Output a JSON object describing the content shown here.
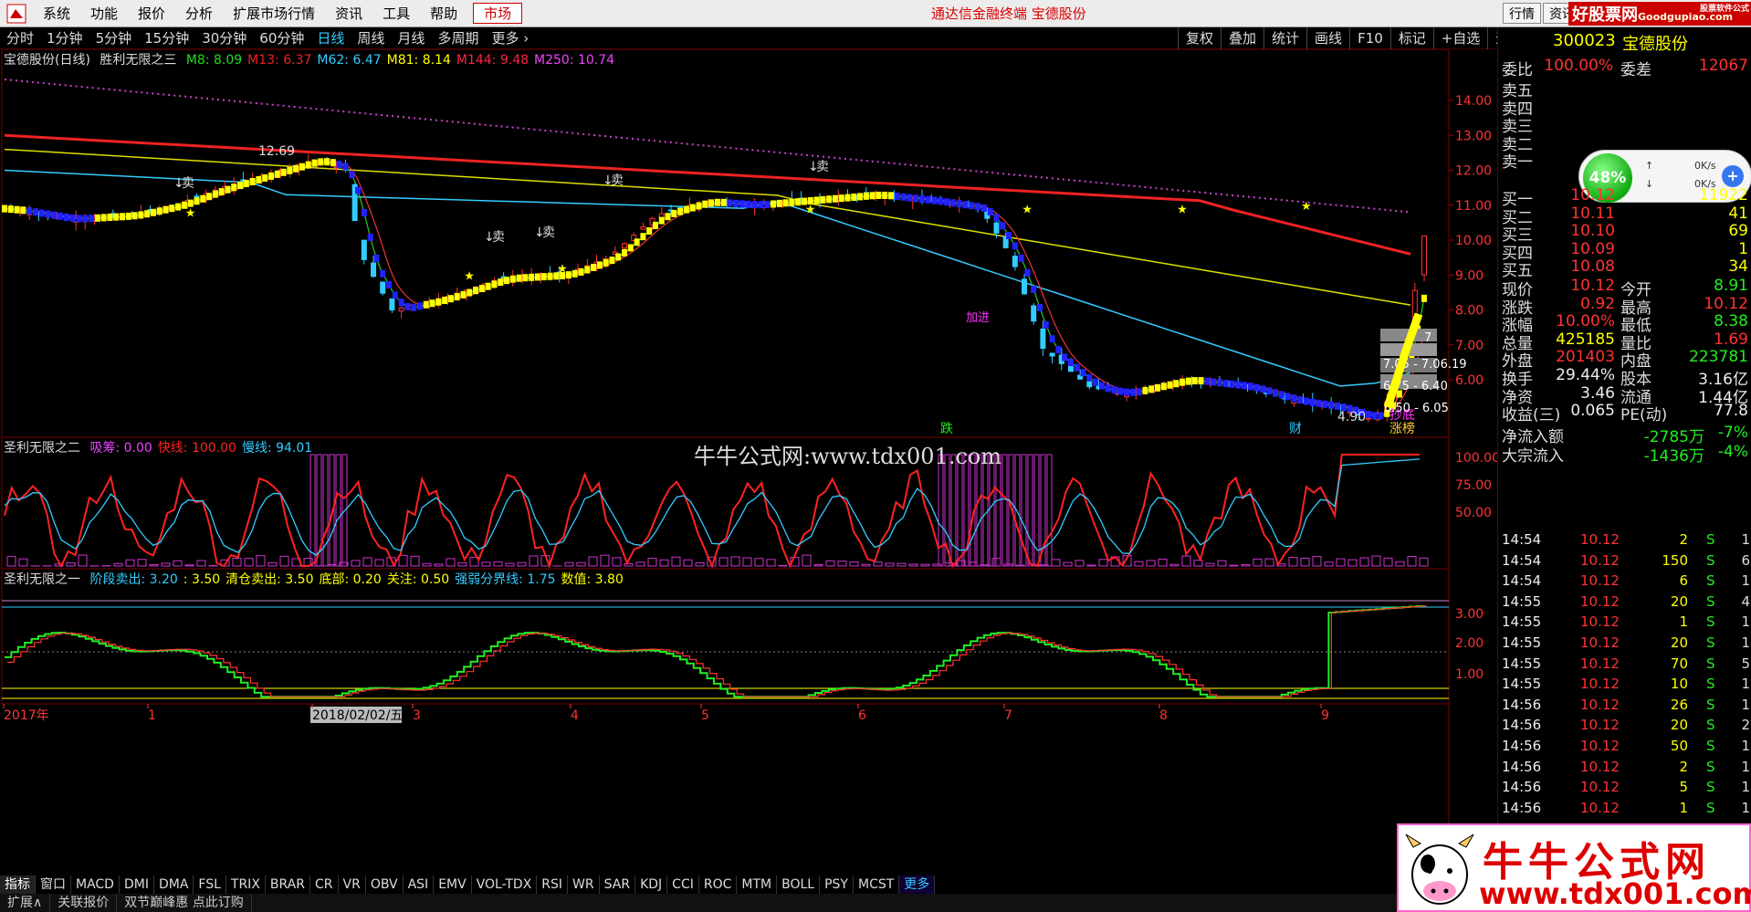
{
  "menu": {
    "items": [
      "系统",
      "功能",
      "报价",
      "分析",
      "扩展市场行情",
      "资讯",
      "工具",
      "帮助"
    ],
    "market": "市场",
    "center_title": "通达信金融终端  宝德股份",
    "right_btn1": "行情",
    "right_btn2": "资讯",
    "ad_text": "好股票网",
    "ad_sub": "Goodgupiao.com",
    "ad_corner": "股票软件公式"
  },
  "period": {
    "items": [
      "分时",
      "1分钟",
      "5分钟",
      "15分钟",
      "30分钟",
      "60分钟",
      "日线",
      "周线",
      "月线",
      "多周期",
      "更多 ›"
    ],
    "active": "日线"
  },
  "toolbar_right": [
    "复权",
    "叠加",
    "统计",
    "画线",
    "F10",
    "标记",
    "+自选",
    "返回"
  ],
  "main_legend": {
    "title": "宝德股份(日线)",
    "formula": "胜利无限之三",
    "ma": [
      {
        "label": "M8: 8.09",
        "color": "#22dd22"
      },
      {
        "label": "M13: 6.37",
        "color": "#ee2222"
      },
      {
        "label": "M62: 6.47",
        "color": "#33ccff"
      },
      {
        "label": "M81: 8.14",
        "color": "#ffff00"
      },
      {
        "label": "M144: 9.48",
        "color": "#ff2244"
      },
      {
        "label": "M250: 10.74",
        "color": "#ee44ff"
      }
    ]
  },
  "main_axis": [
    "14.00",
    "13.00",
    "12.00",
    "11.00",
    "10.00",
    "9.00",
    "8.00",
    "7.00",
    "6.00"
  ],
  "main_annotations": {
    "high": "12.69",
    "low": "4.90",
    "sells": [
      "卖",
      "卖",
      "卖",
      "卖",
      "卖"
    ],
    "die": "跌",
    "cai": "财",
    "zhang": "涨榜",
    "chaodi": "抄底",
    "jiajin": "加进",
    "box1": "7.05 - 7.06.19",
    "box2": "6.75 - 6.40",
    "box3": "6.50 - 6.05",
    "box4": "7"
  },
  "mid_legend": {
    "formula": "圣利无限之二",
    "items": [
      {
        "label": "吸筹: 0.00",
        "color": "#ee44ff"
      },
      {
        "label": "快线: 100.00",
        "color": "#ff2222"
      },
      {
        "label": "慢线: 94.01",
        "color": "#33ccff"
      }
    ]
  },
  "mid_axis": [
    "100.00",
    "75.00",
    "50.00"
  ],
  "low_legend": {
    "formula": "圣利无限之一",
    "items": [
      {
        "label": "阶段卖出: 3.20",
        "color": "#33ccff"
      },
      {
        "label": ": 3.50",
        "color": "#ffff00"
      },
      {
        "label": "清仓卖出: 3.50",
        "color": "#ffff00"
      },
      {
        "label": "底部: 0.20",
        "color": "#ffff00"
      },
      {
        "label": "关注: 0.50",
        "color": "#ffff00"
      },
      {
        "label": "强弱分界线: 1.75",
        "color": "#33ccff"
      },
      {
        "label": "数值: 3.80",
        "color": "#ffff00"
      }
    ]
  },
  "low_axis": [
    "3.00",
    "2.00",
    "1.00"
  ],
  "date_axis": [
    "2017年",
    "1",
    "2018/02/02/五",
    "3",
    "4",
    "5",
    "6",
    "7",
    "8",
    "9"
  ],
  "ind_tabs": [
    "指标",
    "窗口",
    "MACD",
    "DMI",
    "DMA",
    "FSL",
    "TRIX",
    "BRAR",
    "CR",
    "VR",
    "OBV",
    "ASI",
    "EMV",
    "VOL-TDX",
    "RSI",
    "WR",
    "SAR",
    "KDJ",
    "CCI",
    "ROC",
    "MTM",
    "BOLL",
    "PSY",
    "MCST",
    "更多"
  ],
  "bottom_bar": [
    "扩展∧",
    "关联报价",
    "双节巅峰惠 点此订购"
  ],
  "quote": {
    "code": "300023",
    "name": "宝德股份",
    "weibi_label": "委比",
    "weibi": "100.00%",
    "weicha_label": "委差",
    "weicha": "12067",
    "sells": [
      "卖五",
      "卖四",
      "卖三",
      "卖二",
      "卖一"
    ],
    "buys": [
      {
        "label": "买一",
        "price": "10.12",
        "vol": "11922"
      },
      {
        "label": "买二",
        "price": "10.11",
        "vol": "41"
      },
      {
        "label": "买三",
        "price": "10.10",
        "vol": "69"
      },
      {
        "label": "买四",
        "price": "10.09",
        "vol": "1"
      },
      {
        "label": "买五",
        "price": "10.08",
        "vol": "34"
      }
    ],
    "stats": [
      {
        "l1": "现价",
        "v1": "10.12",
        "c1": "red",
        "l2": "今开",
        "v2": "8.91",
        "c2": "green"
      },
      {
        "l1": "涨跌",
        "v1": "0.92",
        "c1": "red",
        "l2": "最高",
        "v2": "10.12",
        "c2": "red"
      },
      {
        "l1": "涨幅",
        "v1": "10.00%",
        "c1": "red",
        "l2": "最低",
        "v2": "8.38",
        "c2": "green"
      },
      {
        "l1": "总量",
        "v1": "425185",
        "c1": "yellow",
        "l2": "量比",
        "v2": "1.69",
        "c2": "red"
      },
      {
        "l1": "外盘",
        "v1": "201403",
        "c1": "red",
        "l2": "内盘",
        "v2": "223781",
        "c2": "green"
      },
      {
        "l1": "换手",
        "v1": "29.44%",
        "c1": "white",
        "l2": "股本",
        "v2": "3.16亿",
        "c2": "white"
      },
      {
        "l1": "净资",
        "v1": "3.46",
        "c1": "white",
        "l2": "流通",
        "v2": "1.44亿",
        "c2": "white"
      },
      {
        "l1": "收益(三)",
        "v1": "0.065",
        "c1": "white",
        "l2": "PE(动)",
        "v2": "77.8",
        "c2": "white"
      }
    ],
    "flows": [
      {
        "label": "净流入额",
        "value": "-2785万",
        "pct": "-7%"
      },
      {
        "label": "大宗流入",
        "value": "-1436万",
        "pct": "-4%"
      }
    ],
    "bubble": {
      "pct": "48%",
      "up": "0K/s",
      "down": "0K/s",
      "plus": "+"
    }
  },
  "ticks": [
    {
      "t": "14:54",
      "p": "10.12",
      "v": "2",
      "s": "S",
      "n": "1"
    },
    {
      "t": "14:54",
      "p": "10.12",
      "v": "150",
      "s": "S",
      "n": "6"
    },
    {
      "t": "14:54",
      "p": "10.12",
      "v": "6",
      "s": "S",
      "n": "1"
    },
    {
      "t": "14:55",
      "p": "10.12",
      "v": "20",
      "s": "S",
      "n": "4"
    },
    {
      "t": "14:55",
      "p": "10.12",
      "v": "1",
      "s": "S",
      "n": "1"
    },
    {
      "t": "14:55",
      "p": "10.12",
      "v": "20",
      "s": "S",
      "n": "1"
    },
    {
      "t": "14:55",
      "p": "10.12",
      "v": "70",
      "s": "S",
      "n": "5"
    },
    {
      "t": "14:55",
      "p": "10.12",
      "v": "10",
      "s": "S",
      "n": "1"
    },
    {
      "t": "14:56",
      "p": "10.12",
      "v": "26",
      "s": "S",
      "n": "1"
    },
    {
      "t": "14:56",
      "p": "10.12",
      "v": "20",
      "s": "S",
      "n": "2"
    },
    {
      "t": "14:56",
      "p": "10.12",
      "v": "50",
      "s": "S",
      "n": "1"
    },
    {
      "t": "14:56",
      "p": "10.12",
      "v": "2",
      "s": "S",
      "n": "1"
    },
    {
      "t": "14:56",
      "p": "10.12",
      "v": "5",
      "s": "S",
      "n": "1"
    },
    {
      "t": "14:56",
      "p": "10.12",
      "v": "1",
      "s": "S",
      "n": "1"
    }
  ],
  "watermark": {
    "center": "牛牛公式网:www.tdx001.com",
    "title": "牛牛公式网",
    "url": "www.tdx001.com"
  }
}
